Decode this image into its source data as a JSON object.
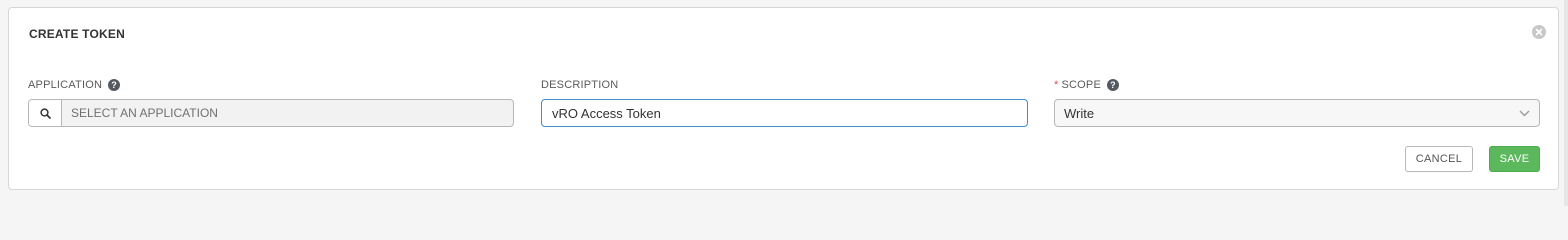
{
  "panel": {
    "title": "CREATE TOKEN",
    "close_icon": "close-circle-icon"
  },
  "fields": {
    "application": {
      "label": "APPLICATION",
      "help_icon": "question-circle-icon",
      "search_icon": "search-icon",
      "placeholder": "SELECT AN APPLICATION",
      "value": ""
    },
    "description": {
      "label": "DESCRIPTION",
      "value": "vRO Access Token"
    },
    "scope": {
      "required_marker": "*",
      "label": "SCOPE",
      "help_icon": "question-circle-icon",
      "value": "Write",
      "chevron_icon": "chevron-down-icon"
    }
  },
  "actions": {
    "cancel_label": "CANCEL",
    "save_label": "SAVE"
  },
  "colors": {
    "save_button": "#5cb85c",
    "focus_border": "#3d8ec9",
    "required": "#d9534f"
  }
}
